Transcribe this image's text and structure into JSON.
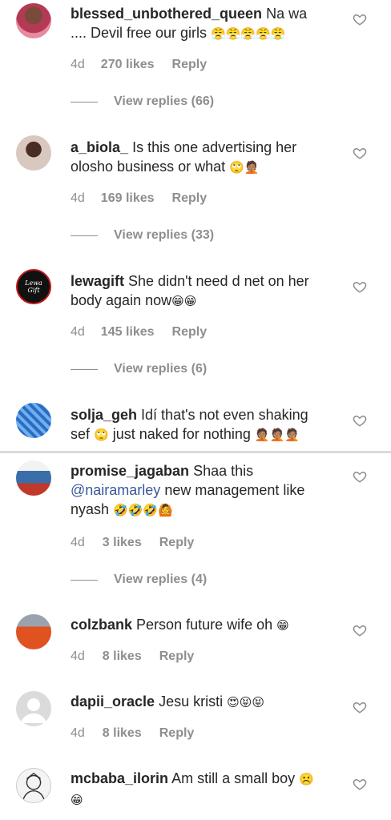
{
  "comments": [
    {
      "user": "blessed_unbothered_queen",
      "text": "Na wa .... Devil free our girls",
      "emoji": "😤😤😤😤😤",
      "age": "4d",
      "likes": "270 likes",
      "reply": "Reply",
      "view_replies": "View replies (66)"
    },
    {
      "user": "a_biola_",
      "text": "Is this one advertising her olosho business or what",
      "emoji": "🙄🤦🏽",
      "age": "4d",
      "likes": "169 likes",
      "reply": "Reply",
      "view_replies": "View replies (33)"
    },
    {
      "user": "lewagift",
      "text": "She didn't need d net on her body again now",
      "emoji": "😁😁",
      "age": "4d",
      "likes": "145 likes",
      "reply": "Reply",
      "view_replies": "View replies (6)"
    },
    {
      "user": "solja_geh",
      "text": "Idí that's not even shaking sef",
      "emoji": "🙄",
      "text2": "just naked for nothing",
      "emoji2": "🤦🏽🤦🏽🤦🏽"
    },
    {
      "user": "promise_jagaban",
      "text": "Shaa this",
      "mention": "@nairamarley",
      "text2": "new management like nyash",
      "emoji": "🤣🤣🤣🙆",
      "age": "4d",
      "likes": "3 likes",
      "reply": "Reply",
      "view_replies": "View replies (4)"
    },
    {
      "user": "colzbank",
      "text": "Person future wife oh",
      "emoji": "😁",
      "age": "4d",
      "likes": "8 likes",
      "reply": "Reply"
    },
    {
      "user": "dapii_oracle",
      "text": "Jesu kristi",
      "emoji": "😍😝😝",
      "age": "4d",
      "likes": "8 likes",
      "reply": "Reply"
    },
    {
      "user": "mcbaba_ilorin",
      "text": "Am still a small boy",
      "emoji": "☹️",
      "emoji2": "😁"
    }
  ],
  "avatars": {
    "a3": "Lewa Gift"
  },
  "icons": {
    "like": "heart-outline-icon"
  },
  "colors": {
    "meta": "#8e8e8e",
    "text": "#262626",
    "mention": "#385898",
    "divider": "#dbdbdb"
  }
}
